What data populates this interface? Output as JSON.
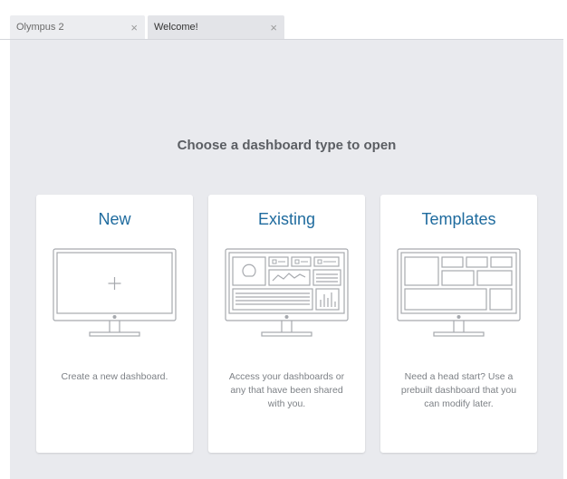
{
  "tabs": [
    {
      "label": "Olympus 2",
      "close": "×"
    },
    {
      "label": "Welcome!",
      "close": "×"
    }
  ],
  "main": {
    "heading": "Choose a dashboard type to open",
    "cards": [
      {
        "title": "New",
        "description": "Create a new dashboard.",
        "icon": "blank-monitor-icon"
      },
      {
        "title": "Existing",
        "description": "Access your dashboards or any that have been shared with you.",
        "icon": "existing-dashboard-monitor-icon"
      },
      {
        "title": "Templates",
        "description": "Need a head start? Use a prebuilt dashboard that you can modify later.",
        "icon": "template-layout-monitor-icon"
      }
    ]
  },
  "colors": {
    "accent": "#1f6b9e",
    "background": "#e9eaee",
    "icon_stroke": "#a6a9ae"
  }
}
